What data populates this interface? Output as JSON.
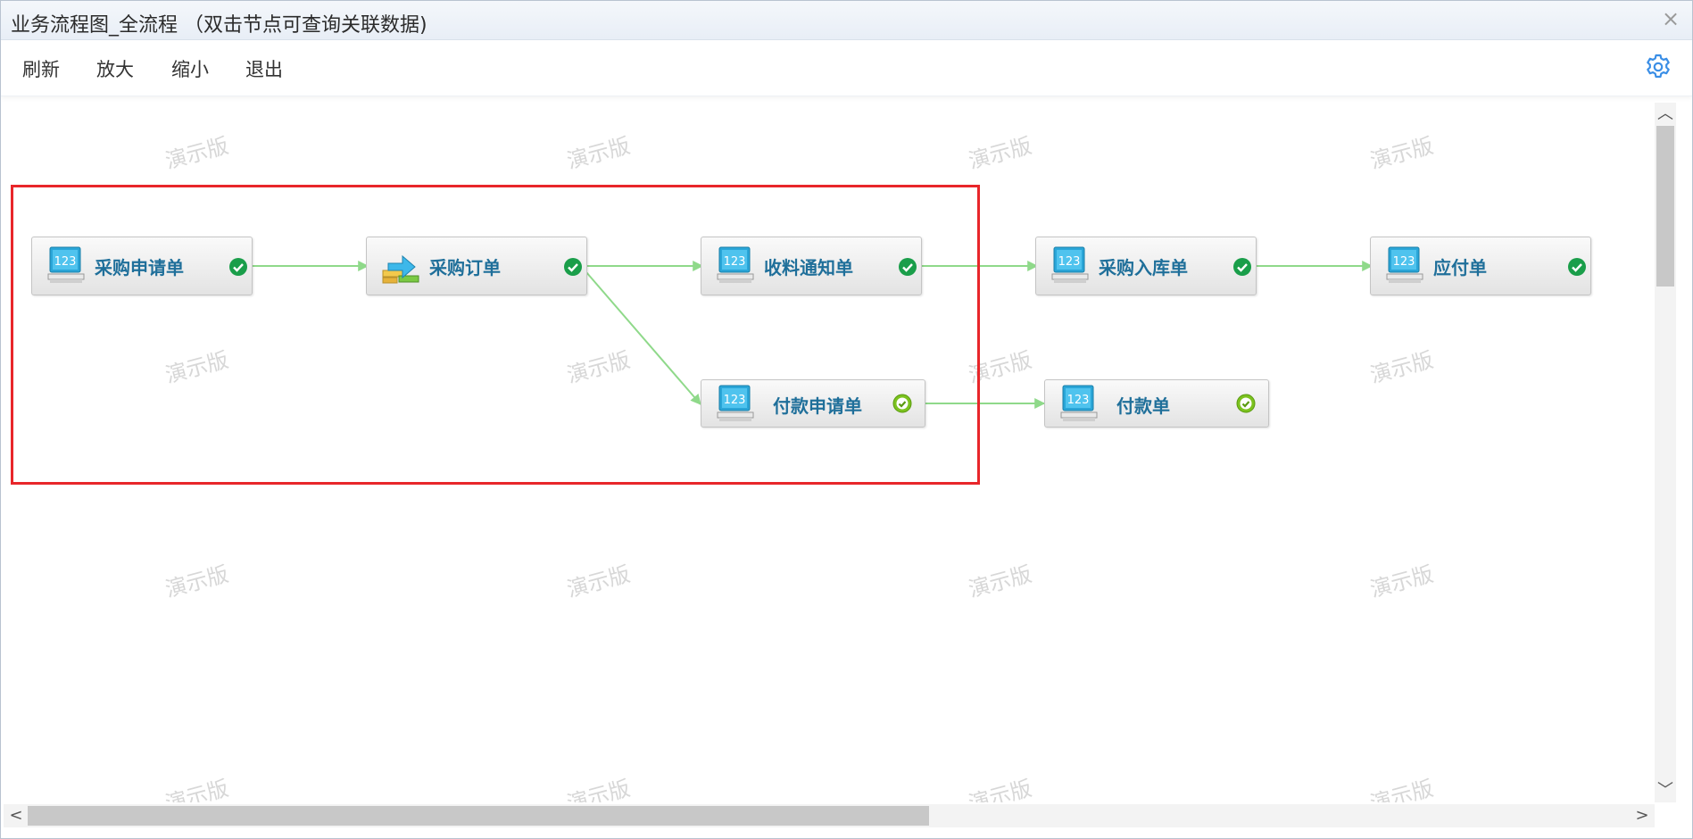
{
  "window": {
    "title": "业务流程图_全流程 （双击节点可查询关联数据)",
    "close_label": "×"
  },
  "toolbar": {
    "refresh_label": "刷新",
    "zoom_in_label": "放大",
    "zoom_out_label": "缩小",
    "exit_label": "退出",
    "settings_icon": "gear-icon"
  },
  "watermark_text": "演示版",
  "flow": {
    "nodes": [
      {
        "id": "n1",
        "label": "采购申请单",
        "icon": "numeric-form-icon",
        "status": "approved"
      },
      {
        "id": "n2",
        "label": "采购订单",
        "icon": "order-transfer-icon",
        "status": "approved"
      },
      {
        "id": "n3",
        "label": "收料通知单",
        "icon": "numeric-form-icon",
        "status": "approved"
      },
      {
        "id": "n4",
        "label": "采购入库单",
        "icon": "numeric-form-icon",
        "status": "approved"
      },
      {
        "id": "n5",
        "label": "应付单",
        "icon": "numeric-form-icon",
        "status": "approved"
      },
      {
        "id": "n6",
        "label": "付款申请单",
        "icon": "numeric-form-icon",
        "status": "approved"
      },
      {
        "id": "n7",
        "label": "付款单",
        "icon": "numeric-form-icon",
        "status": "approved"
      }
    ],
    "edges": [
      {
        "from": "采购申请单",
        "to": "采购订单"
      },
      {
        "from": "采购订单",
        "to": "收料通知单"
      },
      {
        "from": "收料通知单",
        "to": "采购入库单"
      },
      {
        "from": "采购入库单",
        "to": "应付单"
      },
      {
        "from": "采购订单",
        "to": "付款申请单"
      },
      {
        "from": "付款申请单",
        "to": "付款单"
      }
    ]
  },
  "colors": {
    "edge": "#8fd98a",
    "check_green": "#1a9e4a",
    "check_lime": "#7cc21f",
    "selection": "#e8262a",
    "node_label": "#1f6f9a"
  }
}
